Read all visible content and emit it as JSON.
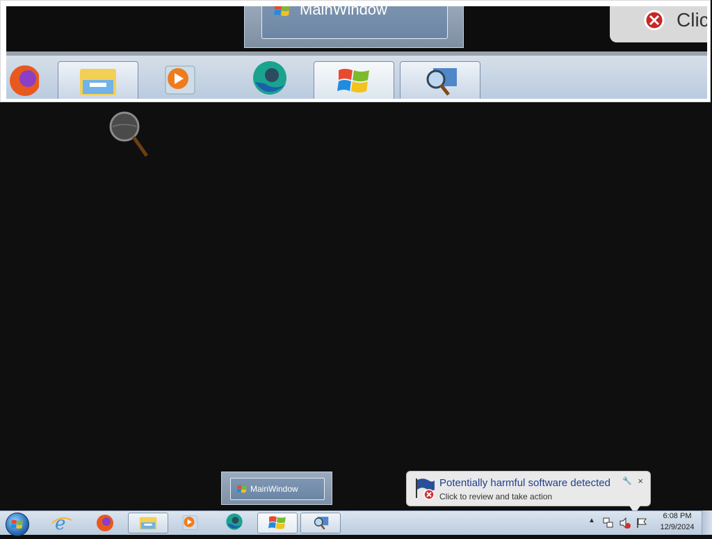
{
  "magnifier": {
    "preview_label": "MainWindow",
    "balloon_text": "Clic"
  },
  "thumbnail": {
    "label": "MainWindow"
  },
  "notification": {
    "title": "Potentially harmful software detected",
    "body": "Click to review and take action",
    "close": "×",
    "options_icon": "wrench-icon"
  },
  "taskbar": {
    "items": [
      {
        "name": "internet-explorer-icon"
      },
      {
        "name": "firefox-icon"
      },
      {
        "name": "file-explorer-icon"
      },
      {
        "name": "media-player-icon"
      },
      {
        "name": "edge-icon"
      },
      {
        "name": "windows-flag-icon"
      },
      {
        "name": "magnifier-icon"
      }
    ]
  },
  "clock": {
    "time": "6:08 PM",
    "date": "12/9/2024"
  },
  "colors": {
    "taskbar": "#c8d6e6",
    "notification_title": "#1f3f8f"
  }
}
